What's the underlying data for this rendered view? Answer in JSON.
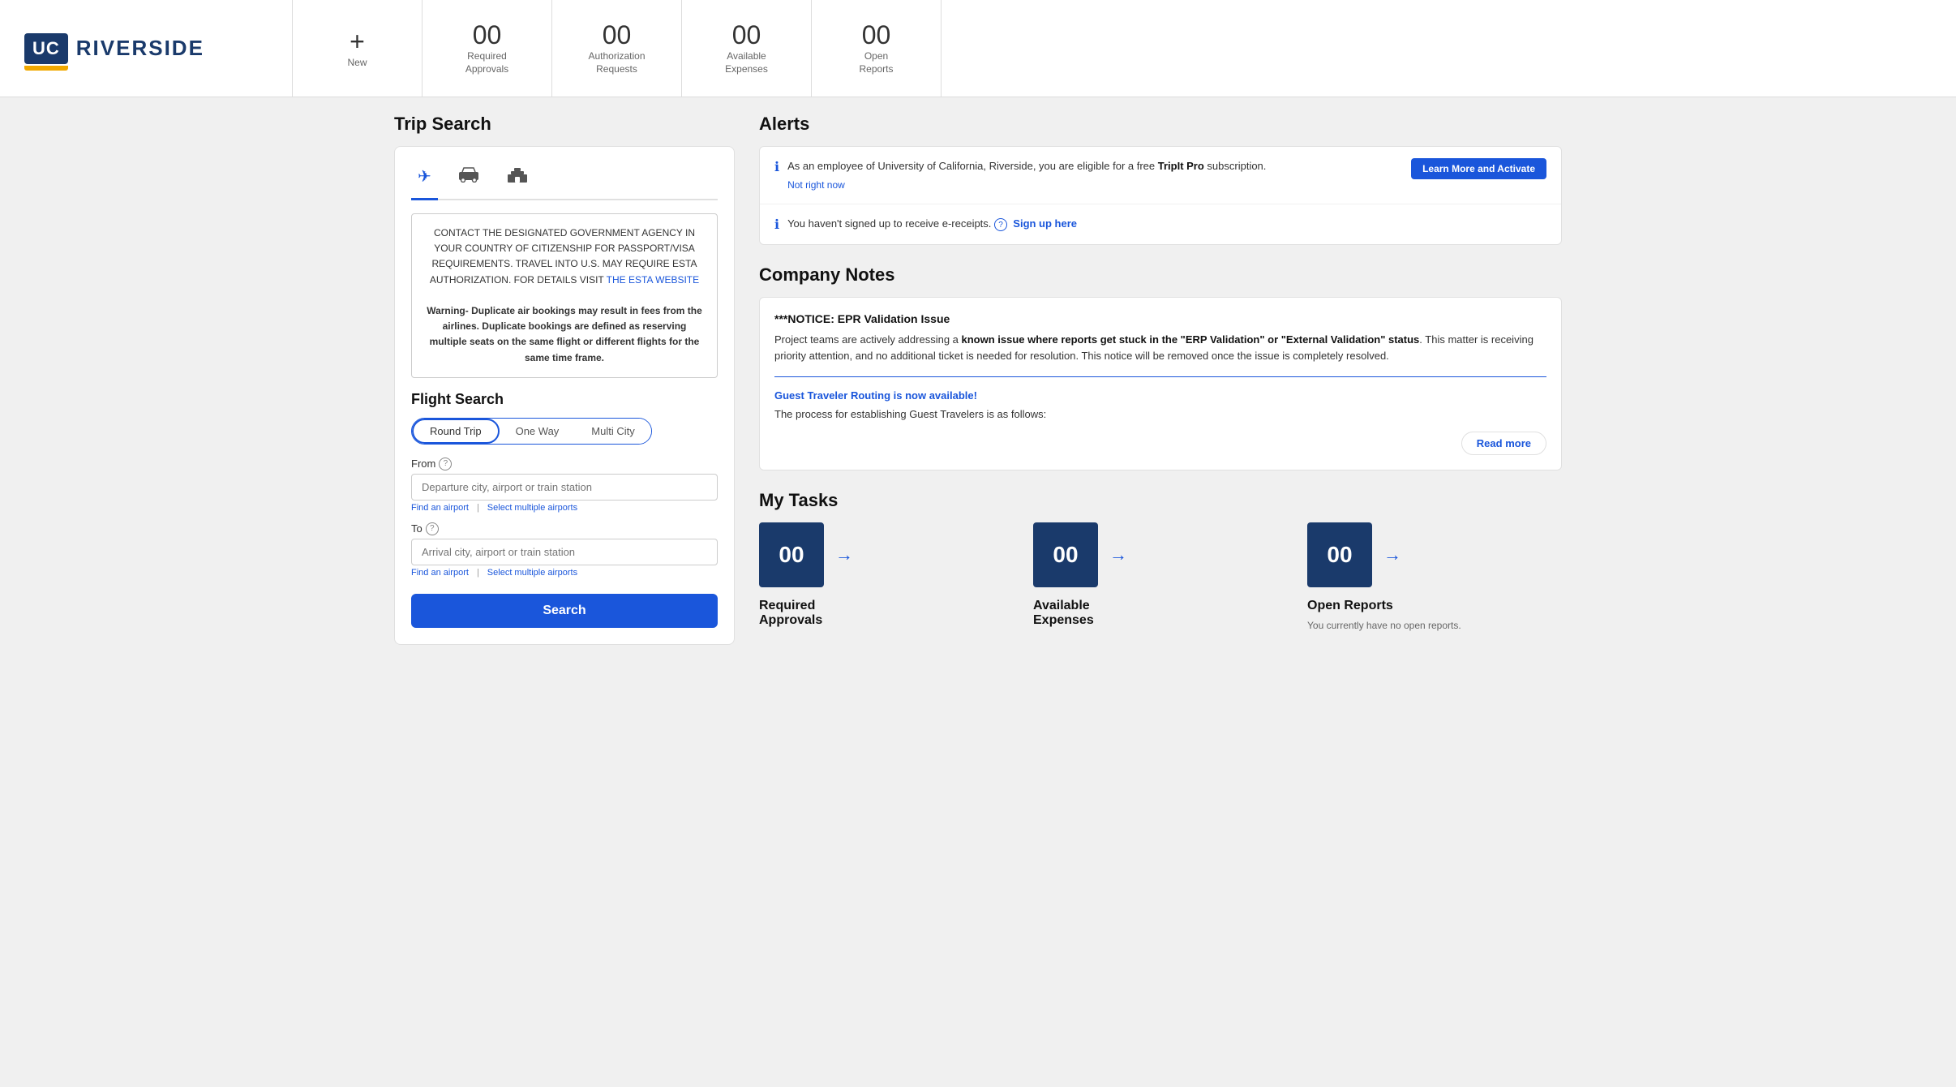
{
  "header": {
    "logo_uc": "UC",
    "logo_riverside": "RIVERSIDE",
    "nav_items": [
      {
        "id": "new",
        "icon": "+",
        "label": "New",
        "number": null
      },
      {
        "id": "required-approvals",
        "icon": null,
        "number": "00",
        "label": "Required\nApprovals"
      },
      {
        "id": "authorization-requests",
        "icon": null,
        "number": "00",
        "label": "Authorization\nRequests"
      },
      {
        "id": "available-expenses",
        "icon": null,
        "number": "00",
        "label": "Available\nExpenses"
      },
      {
        "id": "open-reports",
        "icon": null,
        "number": "00",
        "label": "Open\nReports"
      }
    ]
  },
  "left_panel": {
    "title": "Trip Search",
    "transport_tabs": [
      {
        "id": "flight",
        "icon": "✈",
        "active": true
      },
      {
        "id": "car",
        "icon": "🚗",
        "active": false
      },
      {
        "id": "hotel",
        "icon": "🛏",
        "active": false
      }
    ],
    "visa_notice": "CONTACT THE DESIGNATED GOVERNMENT AGENCY IN YOUR COUNTRY OF CITIZENSHIP FOR PASSPORT/VISA REQUIREMENTS. TRAVEL INTO U.S. MAY REQUIRE ESTA AUTHORIZATION. FOR DETAILS VISIT",
    "esta_link_text": "THE ESTA WEBSITE",
    "warning_text": "Warning- Duplicate air bookings may result in fees from the airlines. Duplicate bookings are defined as reserving multiple seats on the same flight or different flights for the same time frame.",
    "flight_search_title": "Flight Search",
    "trip_types": [
      {
        "id": "round-trip",
        "label": "Round Trip",
        "active": true
      },
      {
        "id": "one-way",
        "label": "One Way",
        "active": false
      },
      {
        "id": "multi-city",
        "label": "Multi City",
        "active": false
      }
    ],
    "from_label": "From",
    "from_placeholder": "Departure city, airport or train station",
    "to_label": "To",
    "to_placeholder": "Arrival city, airport or train station",
    "find_airport_label": "Find an airport",
    "select_multiple_label": "Select multiple airports",
    "search_btn_label": "Search"
  },
  "alerts": {
    "title": "Alerts",
    "items": [
      {
        "id": "tripit-alert",
        "text_before": "As an employee of University of California, Riverside, you are eligible for a free ",
        "strong_text": "TripIt Pro",
        "text_after": " subscription.",
        "activate_label": "Learn More and Activate",
        "not_now_label": "Not right now"
      },
      {
        "id": "ereceipt-alert",
        "text": "You haven't signed up to receive e-receipts.",
        "sign_up_label": "Sign up here"
      }
    ]
  },
  "company_notes": {
    "title": "Company Notes",
    "notice_title": "***NOTICE: EPR Validation Issue",
    "notice_body_before": "Project teams are actively addressing a ",
    "notice_body_strong": "known issue where reports get stuck in the \"ERP Validation\" or \"External Validation\" status",
    "notice_body_after": ". This matter is receiving priority attention, and no additional ticket is needed for resolution. This notice will be removed once the issue is completely resolved.",
    "guest_routing_link": "Guest Traveler Routing is now available!",
    "guest_routing_body": "The process for establishing Guest Travelers is as follows:",
    "read_more_label": "Read more"
  },
  "my_tasks": {
    "title": "My Tasks",
    "tasks": [
      {
        "id": "required-approvals",
        "number": "00",
        "label": "Required\nApprovals",
        "sub": null
      },
      {
        "id": "available-expenses",
        "number": "00",
        "label": "Available\nExpenses",
        "sub": null
      },
      {
        "id": "open-reports",
        "number": "00",
        "label": "Open Reports",
        "sub": "You currently have no open reports."
      }
    ]
  },
  "colors": {
    "primary_blue": "#1a56db",
    "dark_blue": "#1a3a6b",
    "accent_gold": "#f0a800"
  }
}
